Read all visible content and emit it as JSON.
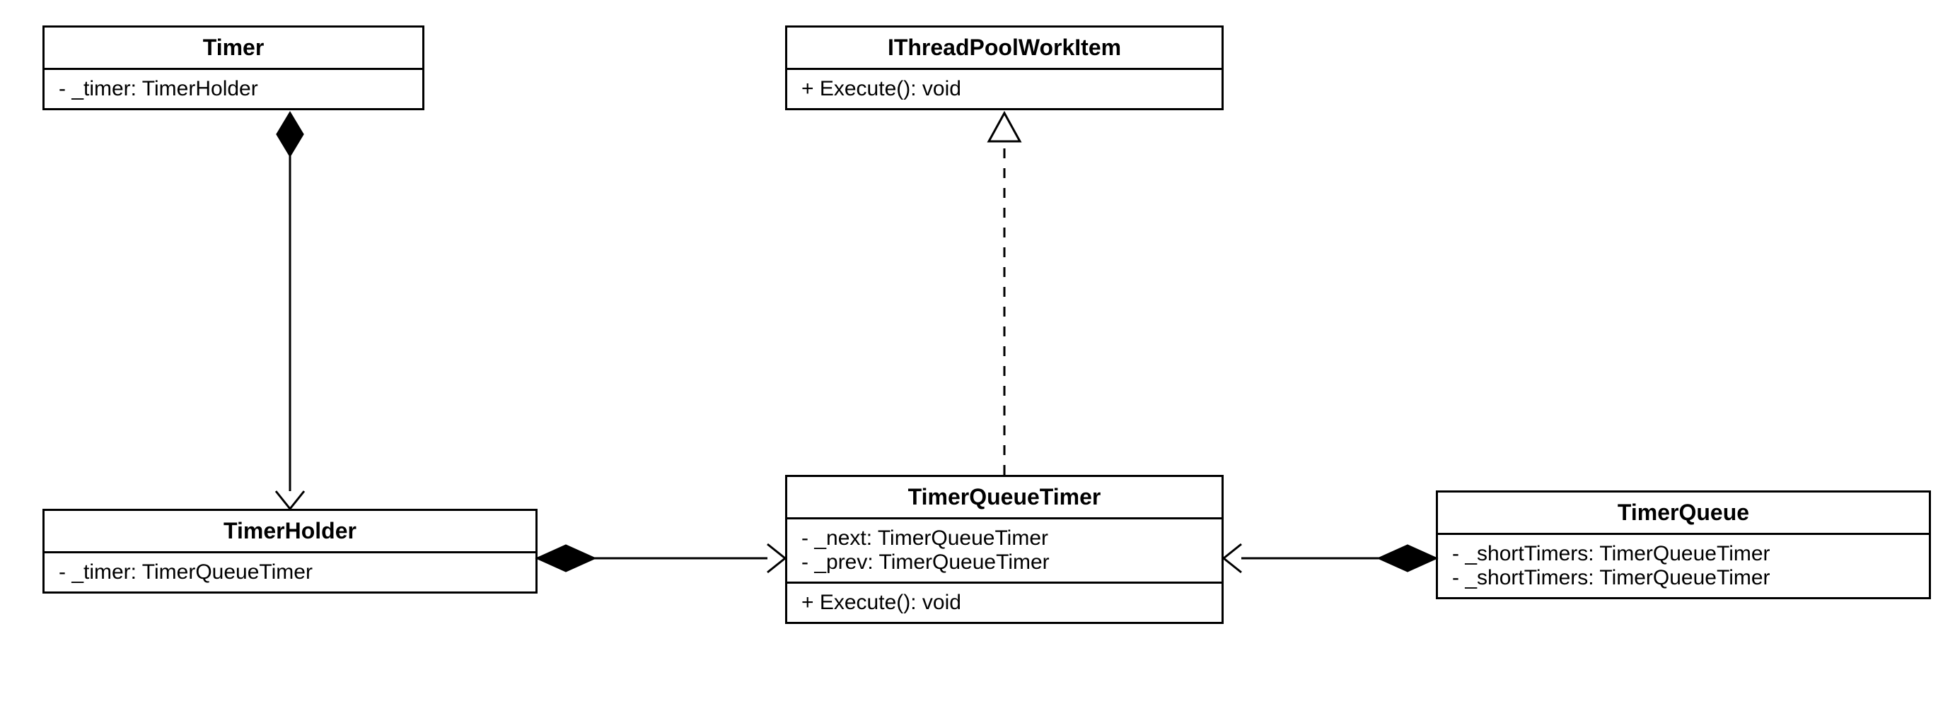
{
  "diagram_type": "UML Class Diagram",
  "classes": {
    "timer": {
      "name": "Timer",
      "attributes": [
        "- _timer: TimerHolder"
      ]
    },
    "ithreadpoolworkitem": {
      "name": "IThreadPoolWorkItem",
      "methods": [
        "+ Execute(): void"
      ]
    },
    "timerholder": {
      "name": "TimerHolder",
      "attributes": [
        "- _timer: TimerQueueTimer"
      ]
    },
    "timerqueuetimer": {
      "name": "TimerQueueTimer",
      "attributes": [
        "- _next: TimerQueueTimer",
        "- _prev: TimerQueueTimer"
      ],
      "methods": [
        "+ Execute(): void"
      ]
    },
    "timerqueue": {
      "name": "TimerQueue",
      "attributes": [
        "- _shortTimers: TimerQueueTimer",
        "- _shortTimers: TimerQueueTimer"
      ]
    }
  },
  "relationships": [
    {
      "from": "Timer",
      "to": "TimerHolder",
      "type": "composition"
    },
    {
      "from": "TimerHolder",
      "to": "TimerQueueTimer",
      "type": "composition"
    },
    {
      "from": "TimerQueue",
      "to": "TimerQueueTimer",
      "type": "composition"
    },
    {
      "from": "TimerQueueTimer",
      "to": "IThreadPoolWorkItem",
      "type": "realization"
    }
  ]
}
